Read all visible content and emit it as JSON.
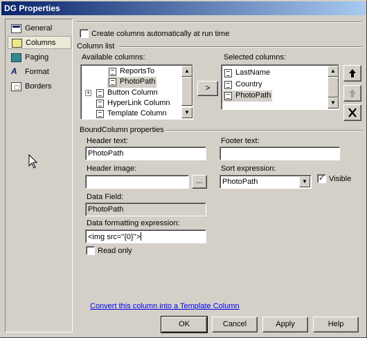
{
  "window": {
    "title": "DG Properties"
  },
  "nav": {
    "items": [
      {
        "label": "General",
        "icon": "general-icon"
      },
      {
        "label": "Columns",
        "icon": "columns-icon"
      },
      {
        "label": "Paging",
        "icon": "paging-icon"
      },
      {
        "label": "Format",
        "icon": "format-icon"
      },
      {
        "label": "Borders",
        "icon": "borders-icon"
      }
    ],
    "selected": "Columns"
  },
  "columns": {
    "auto_generate_label": "Create columns automatically at run time",
    "auto_generate_checked": false,
    "column_list_label": "Column list",
    "available_label": "Available columns:",
    "available_items": [
      "ReportsTo",
      "PhotoPath",
      "Button Column",
      "HyperLink Column",
      "Template Column"
    ],
    "add_button": ">",
    "selected_label": "Selected columns:",
    "selected_items": [
      "LastName",
      "Country",
      "PhotoPath"
    ],
    "move_up_icon": "arrow-up-icon",
    "move_down_icon": "arrow-down-icon",
    "delete_icon": "delete-x-icon"
  },
  "bound_column": {
    "section_label": "BoundColumn properties",
    "header_text_label": "Header text:",
    "header_text_value": "PhotoPath",
    "footer_text_label": "Footer text:",
    "footer_text_value": "",
    "header_image_label": "Header image:",
    "header_image_value": "",
    "browse_button": "...",
    "sort_expression_label": "Sort expression:",
    "sort_expression_value": "PhotoPath",
    "visible_label": "Visible",
    "visible_checked": true,
    "data_field_label": "Data Field:",
    "data_field_value": "PhotoPath",
    "format_label": "Data formatting expression:",
    "format_value": "<img src=\"{0}\">",
    "read_only_label": "Read only",
    "read_only_checked": false
  },
  "footer": {
    "convert_link": "Convert this column into a Template Column",
    "ok": "OK",
    "cancel": "Cancel",
    "apply": "Apply",
    "help": "Help"
  }
}
